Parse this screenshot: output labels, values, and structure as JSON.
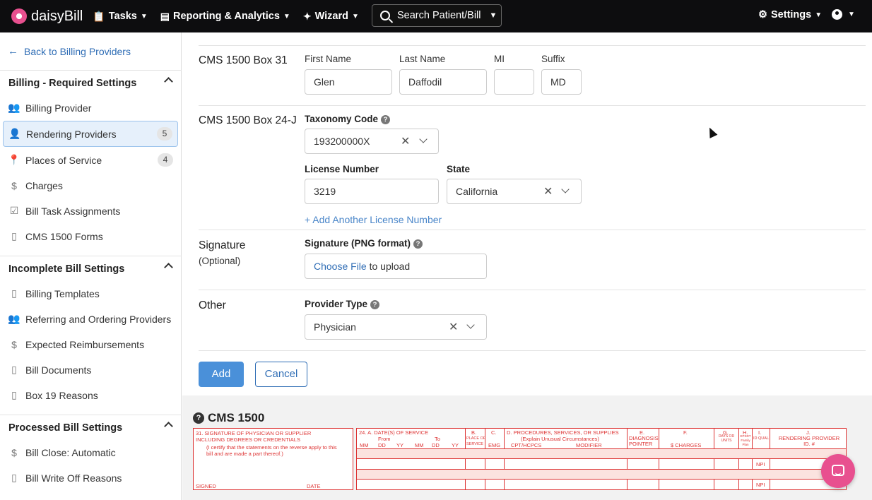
{
  "nav": {
    "brand": "daisyBill",
    "items": [
      {
        "label": "Tasks",
        "icon": "clipboard-icon"
      },
      {
        "label": "Reporting & Analytics",
        "icon": "chart-icon"
      },
      {
        "label": "Wizard",
        "icon": "magic-wand-icon"
      }
    ],
    "search_label": "Search Patient/Bill",
    "settings_label": "Settings"
  },
  "sidebar": {
    "back_label": "Back to Billing Providers",
    "sections": [
      {
        "title": "Billing - Required Settings",
        "items": [
          {
            "label": "Billing Provider",
            "icon": "people-icon"
          },
          {
            "label": "Rendering Providers",
            "icon": "doctor-icon",
            "badge": "5",
            "active": true
          },
          {
            "label": "Places of Service",
            "icon": "pin-icon",
            "badge": "4"
          },
          {
            "label": "Charges",
            "icon": "dollar-icon"
          },
          {
            "label": "Bill Task Assignments",
            "icon": "clipboard-check-icon"
          },
          {
            "label": "CMS 1500 Forms",
            "icon": "document-icon"
          }
        ]
      },
      {
        "title": "Incomplete Bill Settings",
        "items": [
          {
            "label": "Billing Templates",
            "icon": "document-icon"
          },
          {
            "label": "Referring and Ordering Providers",
            "icon": "people-icon"
          },
          {
            "label": "Expected Reimbursements",
            "icon": "dollar-icon"
          },
          {
            "label": "Bill Documents",
            "icon": "document-icon"
          },
          {
            "label": "Box 19 Reasons",
            "icon": "document-icon"
          }
        ]
      },
      {
        "title": "Processed Bill Settings",
        "items": [
          {
            "label": "Bill Close: Automatic",
            "icon": "dollar-icon"
          },
          {
            "label": "Bill Write Off Reasons",
            "icon": "document-icon"
          }
        ]
      }
    ]
  },
  "form": {
    "box31": {
      "label": "CMS 1500 Box 31",
      "first_name_label": "First Name",
      "first_name_value": "Glen",
      "last_name_label": "Last Name",
      "last_name_value": "Daffodil",
      "mi_label": "MI",
      "mi_value": "",
      "suffix_label": "Suffix",
      "suffix_value": "MD"
    },
    "box24j": {
      "label": "CMS 1500 Box 24-J",
      "taxonomy_label": "Taxonomy Code",
      "taxonomy_value": "193200000X",
      "license_label": "License Number",
      "license_value": "3219",
      "state_label": "State",
      "state_value": "California",
      "add_license_label": "+ Add Another License Number"
    },
    "signature": {
      "label": "Signature",
      "sub": "(Optional)",
      "field_label": "Signature (PNG format)",
      "choose_label": "Choose File",
      "upload_label": " to upload"
    },
    "other": {
      "label": "Other",
      "provider_type_label": "Provider Type",
      "provider_type_value": "Physician"
    },
    "add_label": "Add",
    "cancel_label": "Cancel"
  },
  "cms": {
    "title": "CMS 1500",
    "box31_text": "31. SIGNATURE OF PHYSICIAN OR SUPPLIER INCLUDING DEGREES OR CREDENTIALS",
    "box31_note": "(I certify that the statements on the reverse apply to this bill and are made a part thereof.)",
    "signed": "SIGNED",
    "date": "DATE",
    "box24_header": "24. A.  DATE(S) OF SERVICE",
    "from": "From",
    "to": "To",
    "cols": [
      "MM",
      "DD",
      "YY",
      "MM",
      "DD",
      "YY"
    ],
    "b": "B.",
    "b_sub": "PLACE OF SERVICE",
    "c": "C.",
    "c_sub": "EMG",
    "d": "D. PROCEDURES, SERVICES, OR SUPPLIES",
    "d_sub": "(Explain Unusual Circumstances)",
    "cpt": "CPT/HCPCS",
    "modifier": "MODIFIER",
    "e": "E.",
    "e_sub": "DIAGNOSIS POINTER",
    "f": "F.",
    "f_sub": "$ CHARGES",
    "g": "G.",
    "g_sub": "DAYS OR UNITS",
    "h": "H.",
    "h_sub": "EPSDT Family Plan",
    "i": "I.",
    "i_sub": "ID QUAL",
    "j": "J.",
    "j_sub": "RENDERING PROVIDER ID. #",
    "npi": "NPI"
  },
  "colors": {
    "accent": "#4a90d9",
    "link": "#2f6db5",
    "brand_pink": "#e8508f",
    "form_red": "#d33333"
  }
}
